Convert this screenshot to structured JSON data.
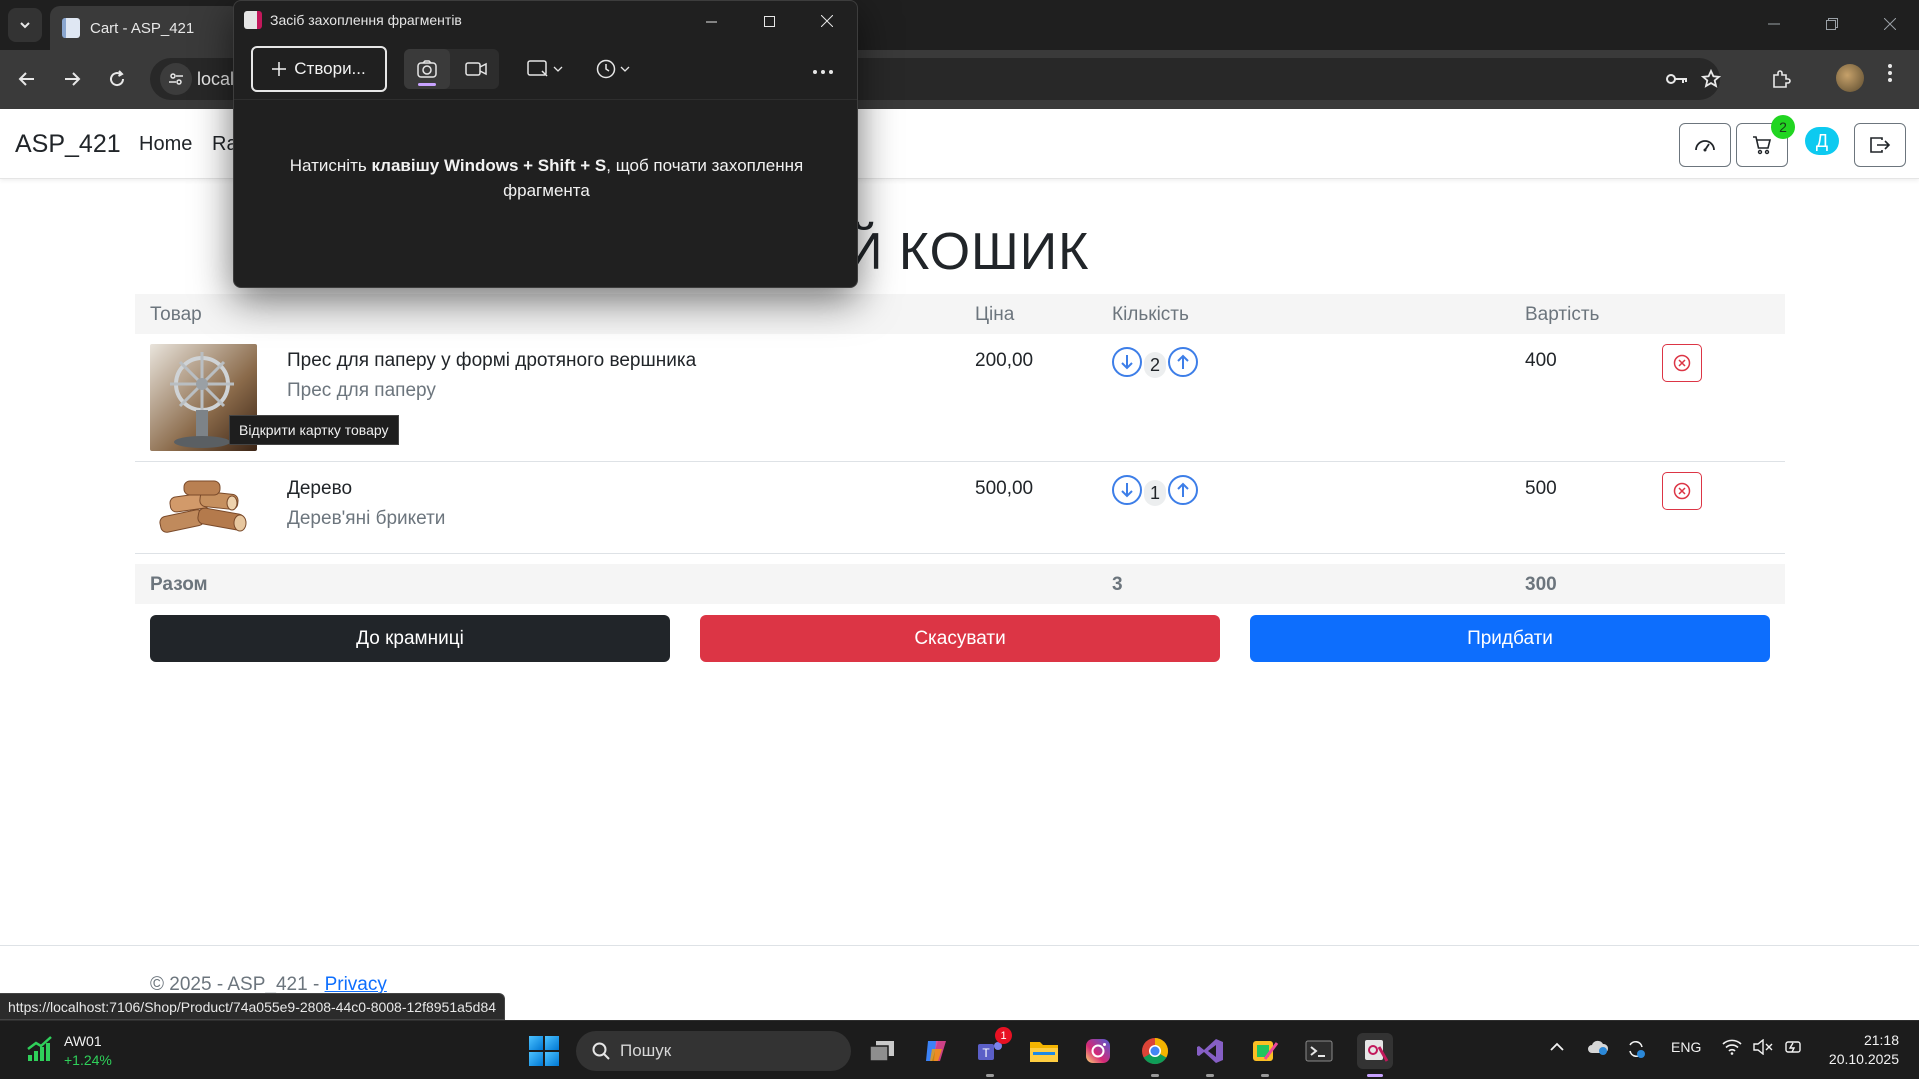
{
  "browser": {
    "tab_title": "Cart - ASP_421",
    "url": "local"
  },
  "site": {
    "brand": "ASP_421",
    "nav_links": [
      "Home",
      "Ra"
    ],
    "cart_count": "2",
    "user_initial": "Д"
  },
  "cart": {
    "title": "ІЙ КОШИК",
    "headers": {
      "product": "Товар",
      "price": "Ціна",
      "quantity": "Кількість",
      "total": "Вартість"
    },
    "items": [
      {
        "name": "Прес для паперу у формі дротяного вершника",
        "description": "Прес для паперу",
        "price": "200,00",
        "quantity": "2",
        "total": "400",
        "image": "wheel-press"
      },
      {
        "name": "Дерево",
        "description": "Дерев'яні брикети",
        "price": "500,00",
        "quantity": "1",
        "total": "500",
        "image": "firewood"
      }
    ],
    "summary": {
      "label": "Разом",
      "quantity": "3",
      "total": "300"
    },
    "buttons": {
      "shop": "До крамниці",
      "cancel": "Скасувати",
      "buy": "Придбати"
    },
    "tooltip": "Відкрити картку товару"
  },
  "footer": {
    "copyright": "© 2025 - ASP_421 -",
    "privacy": "Privacy"
  },
  "status_url": "https://localhost:7106/Shop/Product/74a055e9-2808-44c0-8008-12f8951a5d84",
  "snipping_tool": {
    "title": "Засіб захоплення фрагментів",
    "new_button": "Створи...",
    "msg_before": "Натисніть ",
    "msg_keys": "клавішу Windows + Shift + S",
    "msg_after": ", щоб почати захоплення фрагмента"
  },
  "taskbar": {
    "ticker_name": "AW01",
    "ticker_change": "+1.24%",
    "search_placeholder": "Пошук",
    "teams_badge": "1",
    "language": "ENG",
    "time": "21:18",
    "date": "20.10.2025"
  },
  "colors": {
    "accent_blue": "#0d6efd",
    "danger": "#dc3545",
    "dark": "#212529",
    "badge_green": "#21d521",
    "info": "#0dcaf0"
  }
}
